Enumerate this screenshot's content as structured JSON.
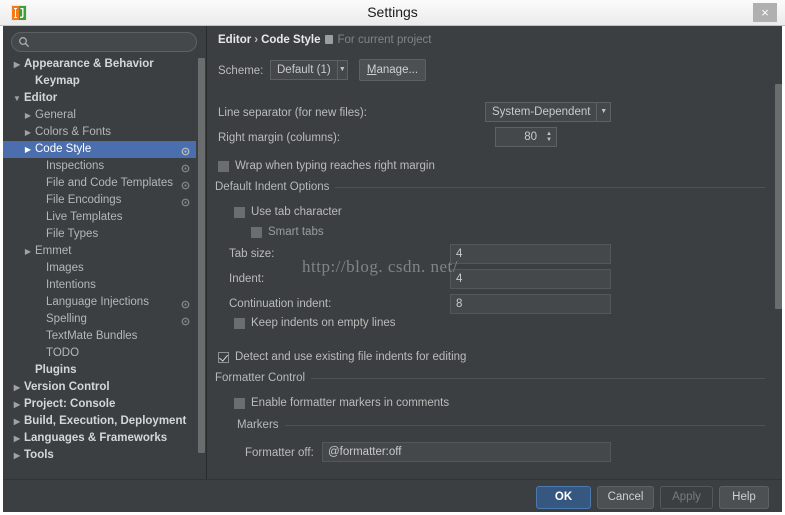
{
  "window": {
    "title": "Settings",
    "app_icon": "intellij-logo-icon",
    "close_label": "×"
  },
  "search": {
    "placeholder": "",
    "value": "",
    "icon": "search-icon"
  },
  "breadcrumb": {
    "root": "Editor",
    "separator": "›",
    "current": "Code Style",
    "scope_label": "For current project",
    "scope_icon": "project-scope-icon"
  },
  "sidebar": {
    "items": [
      {
        "label": "Appearance & Behavior",
        "indent": 0,
        "twisty": "collapsed",
        "bold": true,
        "selected": false,
        "cog": false
      },
      {
        "label": "Keymap",
        "indent": 1,
        "twisty": "none",
        "bold": true,
        "selected": false,
        "cog": false
      },
      {
        "label": "Editor",
        "indent": 0,
        "twisty": "expanded",
        "bold": true,
        "selected": false,
        "cog": false
      },
      {
        "label": "General",
        "indent": 1,
        "twisty": "collapsed",
        "bold": false,
        "selected": false,
        "cog": false
      },
      {
        "label": "Colors & Fonts",
        "indent": 1,
        "twisty": "collapsed",
        "bold": false,
        "selected": false,
        "cog": false
      },
      {
        "label": "Code Style",
        "indent": 1,
        "twisty": "collapsed",
        "bold": false,
        "selected": true,
        "cog": true
      },
      {
        "label": "Inspections",
        "indent": 2,
        "twisty": "none",
        "bold": false,
        "selected": false,
        "cog": true
      },
      {
        "label": "File and Code Templates",
        "indent": 2,
        "twisty": "none",
        "bold": false,
        "selected": false,
        "cog": true
      },
      {
        "label": "File Encodings",
        "indent": 2,
        "twisty": "none",
        "bold": false,
        "selected": false,
        "cog": true
      },
      {
        "label": "Live Templates",
        "indent": 2,
        "twisty": "none",
        "bold": false,
        "selected": false,
        "cog": false
      },
      {
        "label": "File Types",
        "indent": 2,
        "twisty": "none",
        "bold": false,
        "selected": false,
        "cog": false
      },
      {
        "label": "Emmet",
        "indent": 1,
        "twisty": "collapsed",
        "bold": false,
        "selected": false,
        "cog": false
      },
      {
        "label": "Images",
        "indent": 2,
        "twisty": "none",
        "bold": false,
        "selected": false,
        "cog": false
      },
      {
        "label": "Intentions",
        "indent": 2,
        "twisty": "none",
        "bold": false,
        "selected": false,
        "cog": false
      },
      {
        "label": "Language Injections",
        "indent": 2,
        "twisty": "none",
        "bold": false,
        "selected": false,
        "cog": true
      },
      {
        "label": "Spelling",
        "indent": 2,
        "twisty": "none",
        "bold": false,
        "selected": false,
        "cog": true
      },
      {
        "label": "TextMate Bundles",
        "indent": 2,
        "twisty": "none",
        "bold": false,
        "selected": false,
        "cog": false
      },
      {
        "label": "TODO",
        "indent": 2,
        "twisty": "none",
        "bold": false,
        "selected": false,
        "cog": false
      },
      {
        "label": "Plugins",
        "indent": 1,
        "twisty": "none",
        "bold": true,
        "selected": false,
        "cog": false
      },
      {
        "label": "Version Control",
        "indent": 0,
        "twisty": "collapsed",
        "bold": true,
        "selected": false,
        "cog": false
      },
      {
        "label": "Project: Console",
        "indent": 0,
        "twisty": "collapsed",
        "bold": true,
        "selected": false,
        "cog": false
      },
      {
        "label": "Build, Execution, Deployment",
        "indent": 0,
        "twisty": "collapsed",
        "bold": true,
        "selected": false,
        "cog": false
      },
      {
        "label": "Languages & Frameworks",
        "indent": 0,
        "twisty": "collapsed",
        "bold": true,
        "selected": false,
        "cog": false
      },
      {
        "label": "Tools",
        "indent": 0,
        "twisty": "collapsed",
        "bold": true,
        "selected": false,
        "cog": false
      }
    ]
  },
  "form": {
    "scheme_label": "Scheme:",
    "scheme_value": "Default (1)",
    "manage_button": "Manage...",
    "manage_mnemonic": "M",
    "manage_rest": "anage...",
    "line_separator_label": "Line separator (for new files):",
    "line_separator_value": "System-Dependent",
    "right_margin_label": "Right margin (columns):",
    "right_margin_value": "80",
    "wrap_checkbox": "Wrap when typing reaches right margin",
    "wrap_checked": false,
    "default_indent_options_title": "Default Indent Options",
    "use_tab_character": "Use tab character",
    "use_tab_character_checked": false,
    "smart_tabs": "Smart tabs",
    "smart_tabs_checked": false,
    "tab_size_label": "Tab size:",
    "tab_size_value": "4",
    "indent_label": "Indent:",
    "indent_value": "4",
    "continuation_indent_label": "Continuation indent:",
    "continuation_indent_value": "8",
    "keep_indents_label": "Keep indents on empty lines",
    "keep_indents_checked": false,
    "detect_indents_label": "Detect and use existing file indents for editing",
    "detect_indents_checked": true,
    "formatter_control_title": "Formatter Control",
    "enable_formatter_markers": "Enable formatter markers in comments",
    "enable_formatter_markers_checked": false,
    "markers_title": "Markers",
    "formatter_off_label": "Formatter off:",
    "formatter_off_value": "@formatter:off"
  },
  "buttons": {
    "ok": "OK",
    "cancel": "Cancel",
    "apply": "Apply",
    "help": "Help"
  },
  "watermark": "http://blog. csdn. net/",
  "colors": {
    "window_bg": "#3c3f41",
    "titlebar_bg": "#f2f2f2",
    "selection_blue": "#4b6eaf",
    "default_button_blue": "#365880",
    "field_bg": "#45484a",
    "text": "#bbbbbb"
  }
}
